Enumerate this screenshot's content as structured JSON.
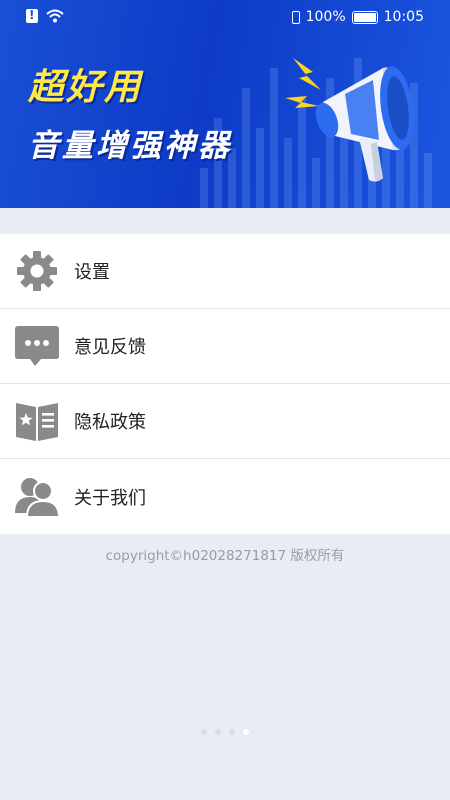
{
  "status_bar": {
    "battery": "100%",
    "time": "10:05"
  },
  "banner": {
    "title_line1": "超好用",
    "title_line2": "音量增强神器"
  },
  "menu": {
    "items": [
      {
        "label": "设置",
        "icon": "gear-icon"
      },
      {
        "label": "意见反馈",
        "icon": "chat-bubble-icon"
      },
      {
        "label": "隐私政策",
        "icon": "book-star-icon"
      },
      {
        "label": "关于我们",
        "icon": "users-icon"
      }
    ]
  },
  "footer": {
    "copyright": "copyright©h02028271817 版权所有"
  },
  "page_indicator": {
    "count": 4,
    "active_index": 3
  },
  "colors": {
    "banner_blue": "#1a4fd6",
    "title_yellow": "#ffe94a",
    "icon_gray": "#8a8a8a",
    "background": "#e9ecf4"
  }
}
